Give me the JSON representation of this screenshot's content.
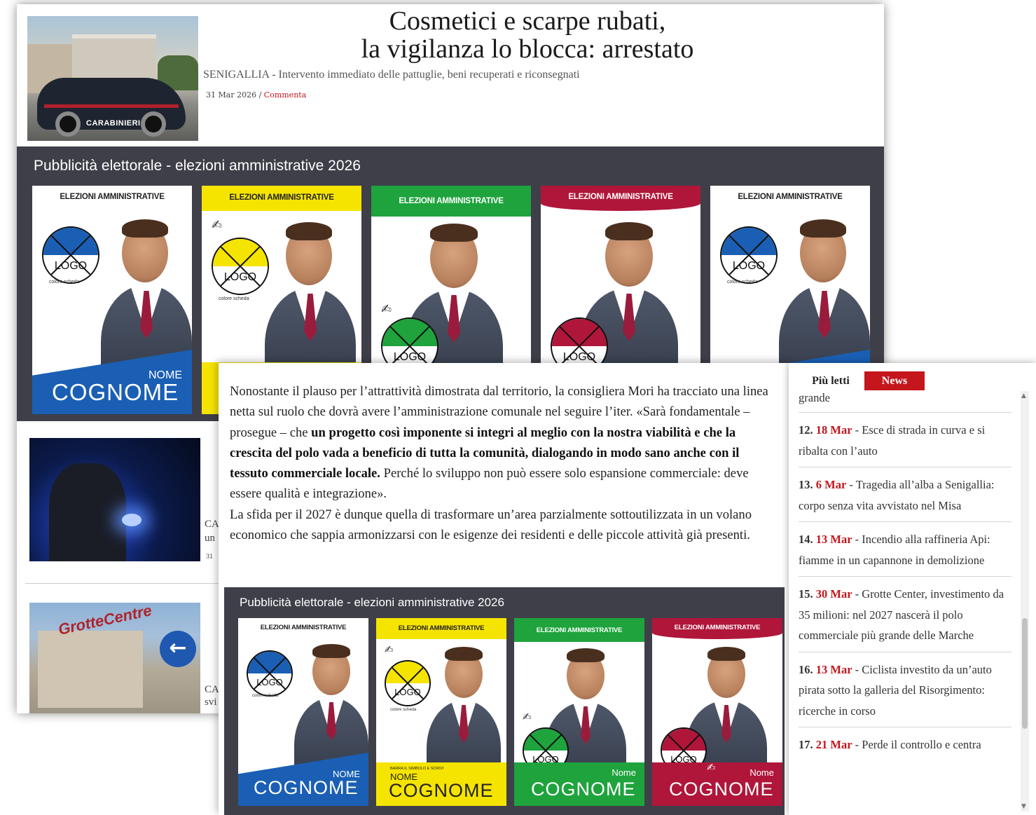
{
  "article": {
    "title_line1": "Cosmetici e scarpe rubati,",
    "title_line2": "la vigilanza lo blocca: arrestato",
    "subtitle": "SENIGALLIA - Intervento immediato delle pattuglie, beni recuperati e riconsegnati",
    "date": "31 Mar 2026",
    "separator": " / ",
    "comment_link": "Commenta",
    "thumb_car_label": "CARABINIERI"
  },
  "ads": {
    "band_title": "Pubblicità elettorale - elezioni amministrative 2026",
    "header_text": "ELEZIONI AMMINISTRATIVE",
    "logo_text": "LOGO",
    "colore_text": "colore scheda",
    "nome_upper": "NOME",
    "nome_title": "Nome",
    "cognome": "COGNOME",
    "barra_text": "BARRA IL SIMBOLO E SCRIVI",
    "pen_icon": "✍",
    "colors": {
      "blue": "#1a5fb4",
      "yellow": "#f5e400",
      "green": "#1fa33d",
      "red": "#b0163a"
    }
  },
  "list": {
    "snippet1_a": "CA",
    "snippet1_b": "un",
    "snippet1_c": "31",
    "snippet2_a": "CA",
    "snippet2_b": "svi",
    "thumb_mall_sign": "GrotteCentre"
  },
  "body": {
    "p1_a": "Nonostante il plauso per l’attrattività dimostrata dal territorio, la consigliera Mori ha tracciato una linea netta sul ruolo che dovrà avere l’amministrazione comunale nel seguire l’iter. «Sarà fondamentale – prosegue – che ",
    "p1_bold": "un progetto così imponente si integri al meglio con la nostra viabilità e che la crescita del polo vada a beneficio di tutta la comunità, dialogando in modo sano anche con il tessuto commerciale locale.",
    "p1_b": " Perché lo sviluppo non può essere solo espansione commerciale: deve essere qualità e integrazione».",
    "p2": "La sfida per il 2027 è dunque quella di trasformare un’area parzialmente sottoutilizzata in un volano economico che sappia armonizzarsi con le esigenze dei residenti e delle piccole attività già presenti."
  },
  "sidebar": {
    "tab_piu_letti": "Più letti",
    "tab_news": "News",
    "fragment": "grande",
    "items": [
      {
        "num": "12.",
        "date": "18 Mar",
        "text": " - Esce di strada in curva e si ribalta con l’auto"
      },
      {
        "num": "13.",
        "date": "6 Mar",
        "text": " - Tragedia all’alba a Senigallia: corpo senza vita avvistato nel Misa"
      },
      {
        "num": "14.",
        "date": "13 Mar",
        "text": " - Incendio alla raffineria Api: fiamme in un capannone in demolizione"
      },
      {
        "num": "15.",
        "date": "30 Mar",
        "text": " - Grotte Center, investimento da 35 milioni: nel 2027 nascerà il polo commerciale più grande delle Marche"
      },
      {
        "num": "16.",
        "date": "13 Mar",
        "text": " - Ciclista investito da un’auto pirata sotto la galleria del Risorgimento: ricerche in corso"
      },
      {
        "num": "17.",
        "date": "21 Mar",
        "text": " - Perde il controllo e centra"
      }
    ]
  }
}
